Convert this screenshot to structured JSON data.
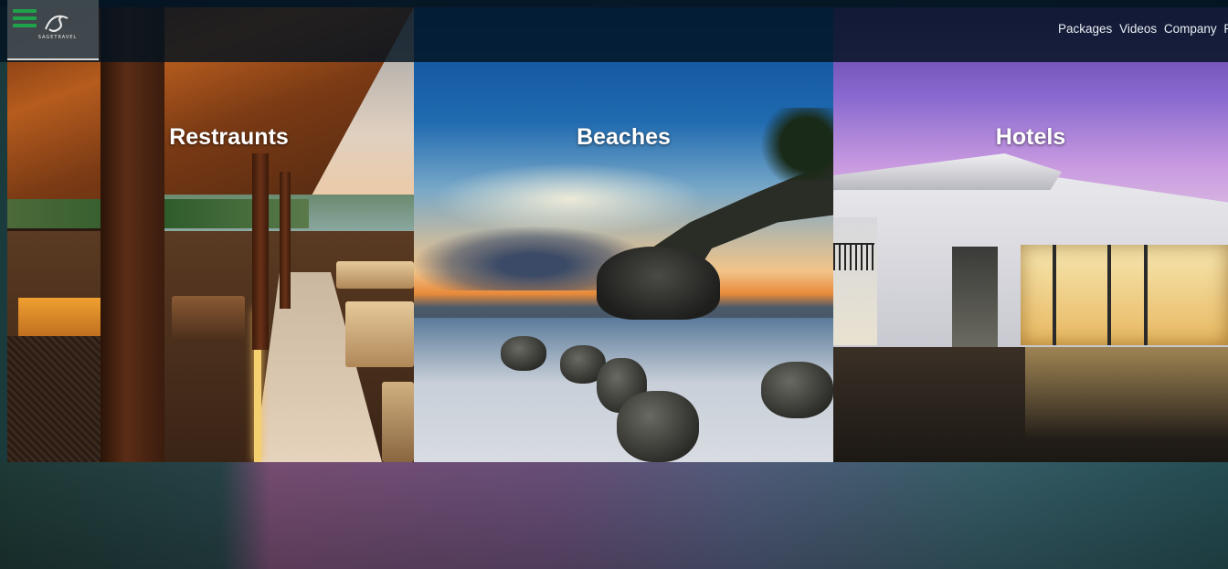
{
  "header": {
    "logo": {
      "brand_text": "SAGETRAVEL",
      "tagline": "",
      "icon": "s-travel-logo-icon"
    },
    "menu_icon": "hamburger-menu-icon",
    "nav": [
      "Packages",
      "Videos",
      "Company",
      "Pa"
    ]
  },
  "cards": [
    {
      "title": "Restraunts",
      "image": "restaurant-deck-photo"
    },
    {
      "title": "Beaches",
      "image": "rocky-beach-sunset-photo"
    },
    {
      "title": "Hotels",
      "image": "hotel-exterior-dusk-photo"
    }
  ],
  "colors": {
    "header_bg": "#021220",
    "menu_icon": "#1fa24a",
    "title_text": "#ffffff"
  }
}
